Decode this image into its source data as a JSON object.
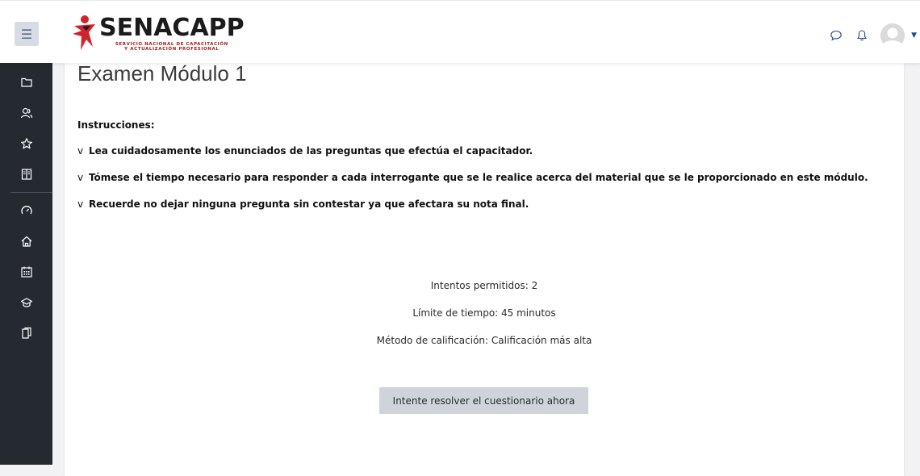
{
  "header": {
    "brand_name": "SENACAPP",
    "brand_tagline_1": "SERVICIO NACIONAL DE CAPACITACIÓN",
    "brand_tagline_2": "Y ACTUALIZACIÓN PROFESIONAL",
    "icons": [
      "menu-icon",
      "message-icon",
      "bell-icon",
      "user-avatar",
      "caret-down-icon"
    ]
  },
  "sidebar": {
    "items": [
      {
        "icon": "folder-icon"
      },
      {
        "icon": "participants-icon"
      },
      {
        "icon": "star-icon"
      },
      {
        "icon": "grades-book-icon"
      },
      {
        "icon": "dashboard-gauge-icon"
      },
      {
        "icon": "home-icon"
      },
      {
        "icon": "calendar-icon"
      },
      {
        "icon": "graduation-cap-icon"
      },
      {
        "icon": "files-icon"
      }
    ]
  },
  "main": {
    "title": "Examen Módulo 1",
    "instructions_heading": "Instrucciones:",
    "bullet_marker": "v",
    "instructions": [
      "Lea cuidadosamente los enunciados de las preguntas que efectúa el capacitador.",
      "Tómese el tiempo necesario para responder a cada interrogante que se le realice acerca del material que se le proporcionado en este módulo.",
      "Recuerde no dejar ninguna pregunta sin contestar ya que afectara su nota final."
    ],
    "attempts_allowed": "Intentos permitidos: 2",
    "time_limit": "Límite de tiempo: 45 minutos",
    "grading_method": "Método de calificación: Calificación más alta",
    "attempt_button": "Intente resolver el cuestionario ahora"
  },
  "colors": {
    "sidebar_bg": "#242a30",
    "toggle_bg": "#d6dbe5",
    "button_bg": "#ced4da",
    "brand_red": "#d2232a"
  }
}
